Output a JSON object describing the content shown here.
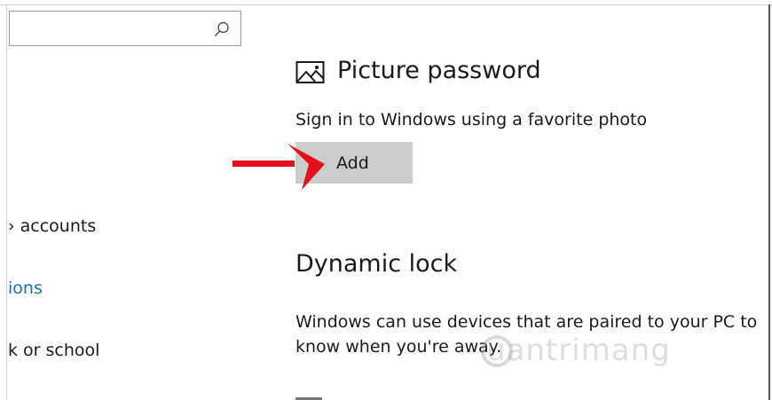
{
  "search": {
    "value": "",
    "placeholder": "",
    "icon": "search-icon"
  },
  "sidebar": {
    "items": [
      {
        "label": "› accounts",
        "active": false
      },
      {
        "label": "ions",
        "active": true
      },
      {
        "label": "k or school",
        "active": false
      }
    ]
  },
  "picture_password": {
    "title": "Picture password",
    "description": "Sign in to Windows using a favorite photo",
    "add_label": "Add",
    "icon": "picture-icon"
  },
  "dynamic_lock": {
    "title": "Dynamic lock",
    "description": "Windows can use devices that are paired to your PC to know when you're away."
  },
  "watermark": {
    "text": "uantrimang"
  },
  "colors": {
    "accent": "#1570c4",
    "button_bg": "#cccccc",
    "arrow": "#e4101c"
  }
}
